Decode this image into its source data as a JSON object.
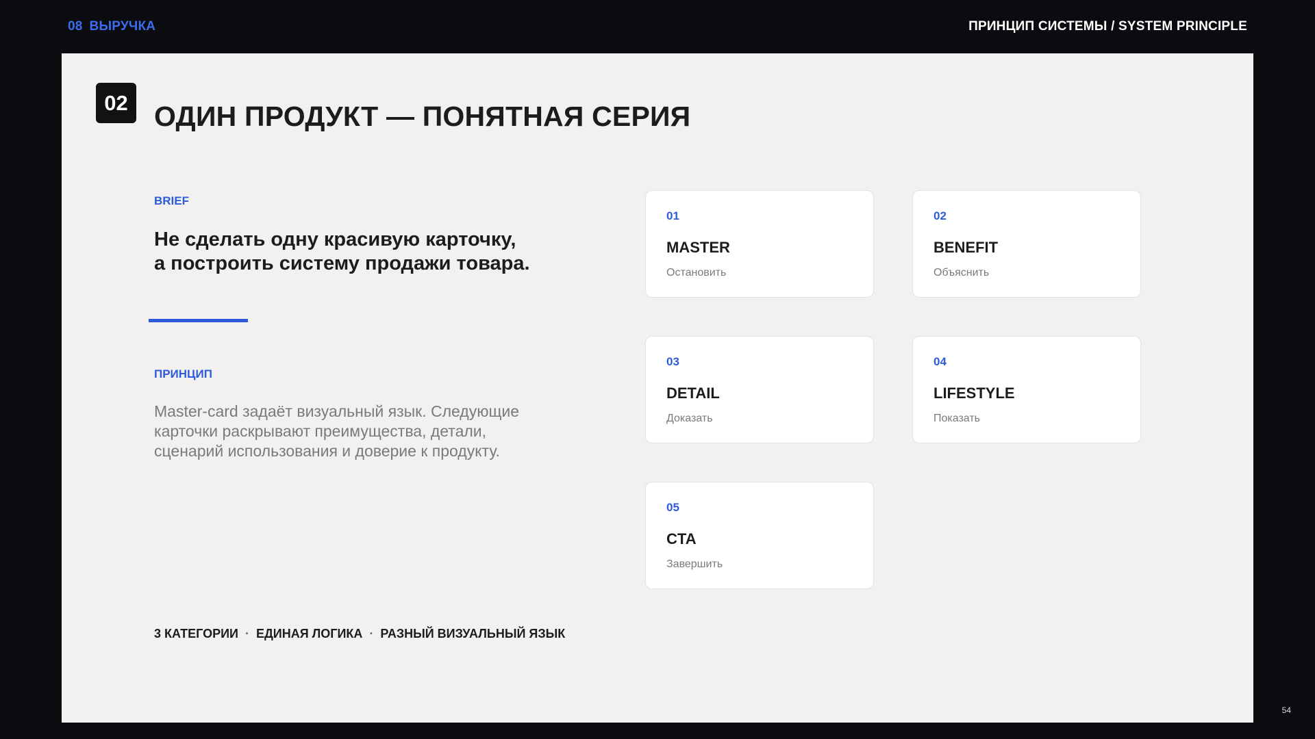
{
  "header": {
    "section_number": "08",
    "section_title": "ВЫРУЧКА",
    "right_title": "ПРИНЦИП СИСТЕМЫ / SYSTEM PRINCIPLE"
  },
  "slide": {
    "badge": "02",
    "title": "ОДИН ПРОДУКТ — ПОНЯТНАЯ СЕРИЯ",
    "brief": {
      "label": "BRIEF",
      "line1": "Не сделать одну красивую карточку,",
      "line2": "а построить систему продажи товара."
    },
    "principle": {
      "label": "ПРИНЦИП",
      "line1": "Master-card задаёт визуальный язык. Следующие",
      "line2": "карточки раскрывают преимущества, детали,",
      "line3": "сценарий использования и доверие к продукту."
    },
    "footer": {
      "tag1": "3 КАТЕГОРИИ",
      "separator": "·",
      "tag2": "ЕДИНАЯ ЛОГИКА",
      "tag3": "РАЗНЫЙ ВИЗУАЛЬНЫЙ ЯЗЫК"
    },
    "cards": [
      {
        "num": "01",
        "title": "MASTER",
        "subtitle": "Остановить"
      },
      {
        "num": "02",
        "title": "BENEFIT",
        "subtitle": "Объяснить"
      },
      {
        "num": "03",
        "title": "DETAIL",
        "subtitle": "Доказать"
      },
      {
        "num": "04",
        "title": "LIFESTYLE",
        "subtitle": "Показать"
      },
      {
        "num": "05",
        "title": "CTA",
        "subtitle": "Завершить"
      }
    ]
  },
  "page_number": "54",
  "colors": {
    "accent": "#2e5bdc",
    "background_outer": "#0a0c10",
    "background_slide": "#f2f1ef"
  }
}
